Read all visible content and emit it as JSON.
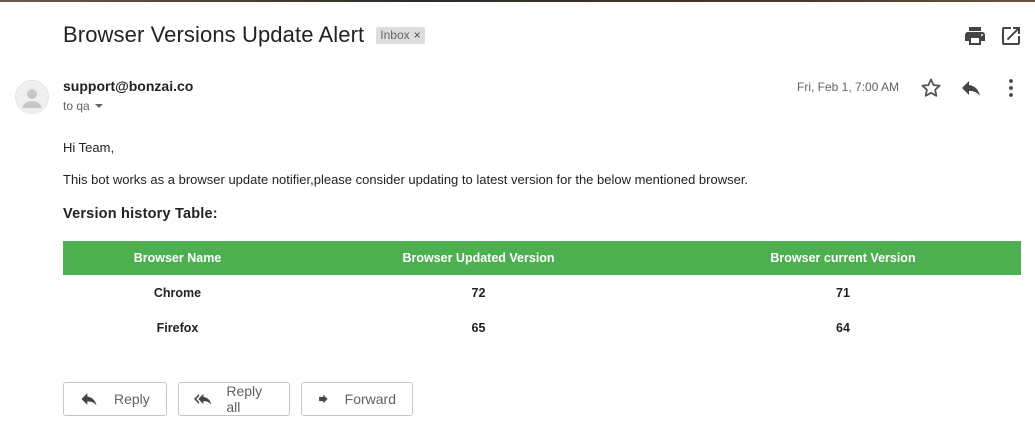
{
  "email": {
    "subject": "Browser Versions Update Alert",
    "label": "Inbox",
    "label_remove": "×",
    "sender": "support@bonzai.co",
    "to_line": "to qa",
    "date": "Fri, Feb 1, 7:00 AM"
  },
  "toolbar": {
    "icons": [
      "print-icon",
      "open-in-new-window-icon"
    ]
  },
  "header_actions": {
    "icons": [
      "star-icon",
      "reply-icon",
      "more-vert-icon"
    ]
  },
  "body": {
    "greeting": "Hi Team,",
    "message": "This bot works as a browser update notifier,please consider updating to latest version for the below mentioned browser.",
    "table_title": "Version history Table:",
    "table": {
      "headers": [
        "Browser Name",
        "Browser Updated Version",
        "Browser current Version"
      ],
      "rows": [
        [
          "Chrome",
          "72",
          "71"
        ],
        [
          "Firefox",
          "65",
          "64"
        ]
      ]
    }
  },
  "actions": {
    "reply": "Reply",
    "reply_all": "Reply all",
    "forward": "Forward"
  },
  "colors": {
    "table_header_bg": "#4caf50",
    "table_header_text": "#ffffff"
  }
}
